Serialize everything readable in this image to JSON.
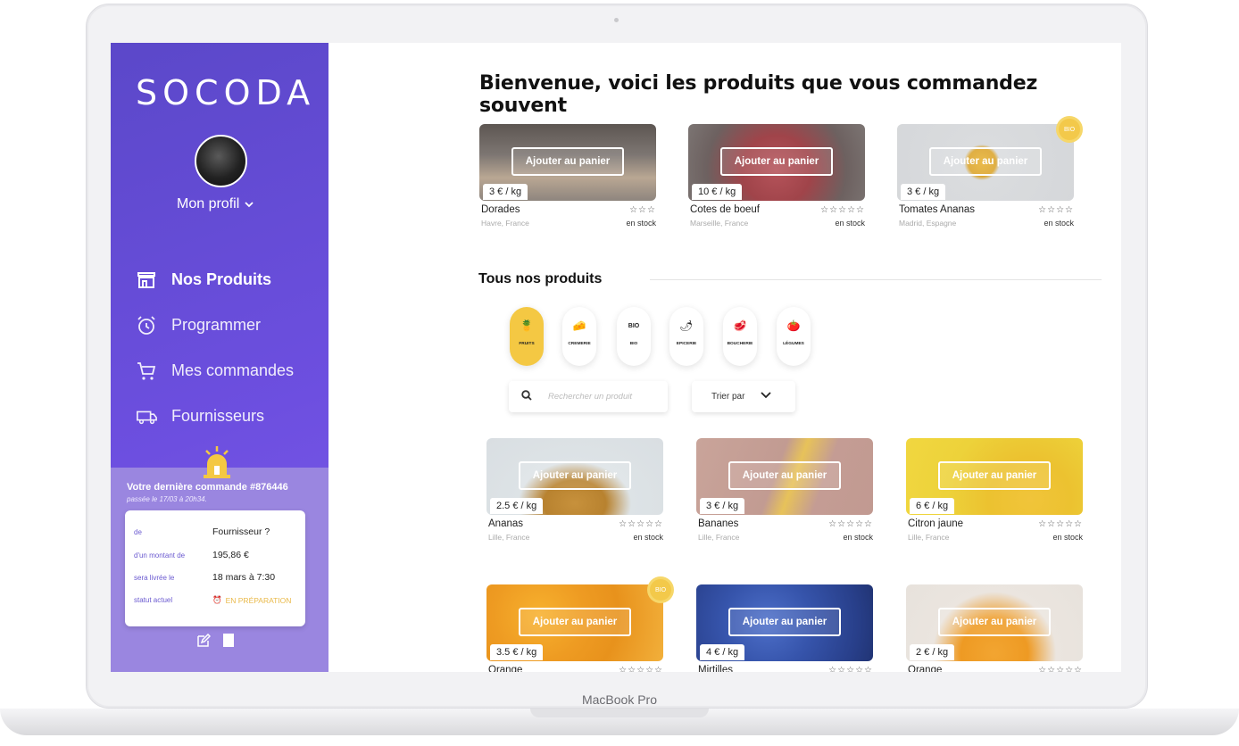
{
  "device": {
    "label": "MacBook Pro"
  },
  "sidebar": {
    "logo": "SOCODA",
    "profile_label": "Mon profil",
    "nav": [
      {
        "label": "Nos Produits",
        "icon": "store-icon",
        "active": true
      },
      {
        "label": "Programmer",
        "icon": "alarm-clock-icon",
        "active": false
      },
      {
        "label": "Mes commandes",
        "icon": "cart-icon",
        "active": false
      },
      {
        "label": "Fournisseurs",
        "icon": "truck-icon",
        "active": false
      }
    ],
    "last_order": {
      "title": "Votre dernière commande #876446",
      "subtitle": "passée le 17/03 à 20h34.",
      "rows": [
        {
          "label": "de",
          "value": "Fournisseur ?"
        },
        {
          "label": "d'un montant de",
          "value": "195,86 €"
        },
        {
          "label": "sera livrée le",
          "value": "18 mars à 7:30"
        },
        {
          "label": "statut actuel",
          "value": "EN PRÉPARATION"
        }
      ]
    }
  },
  "main": {
    "welcome": "Bienvenue, voici les produits que vous commandez souvent",
    "add_button_label": "Ajouter au panier",
    "bio_label": "BIO",
    "favorites": [
      {
        "name": "Dorades",
        "price": "3 € / kg",
        "location": "Havre, France",
        "stock": "en stock",
        "stars": "☆☆☆",
        "bio": false
      },
      {
        "name": "Cotes de boeuf",
        "price": "10 € / kg",
        "location": "Marseille, France",
        "stock": "en stock",
        "stars": "☆☆☆☆☆",
        "bio": false
      },
      {
        "name": "Tomates Ananas",
        "price": "3 € / kg",
        "location": "Madrid, Espagne",
        "stock": "en stock",
        "stars": "☆☆☆☆",
        "bio": true
      }
    ],
    "all_title": "Tous nos produits",
    "categories": [
      {
        "label": "FRUITS",
        "icon": "🍍",
        "active": true
      },
      {
        "label": "CREMERIE",
        "icon": "🧀",
        "active": false
      },
      {
        "label": "BIO",
        "icon": "BIO",
        "active": false
      },
      {
        "label": "EPICERIE",
        "icon": "🌶",
        "active": false
      },
      {
        "label": "BOUCHERIE",
        "icon": "🥩",
        "active": false
      },
      {
        "label": "LÉGUMES",
        "icon": "🍅",
        "active": false
      }
    ],
    "search_placeholder": "Rechercher un produit",
    "sort_label": "Trier par",
    "products": [
      {
        "name": "Ananas",
        "price": "2.5 € / kg",
        "location": "Lille, France",
        "stock": "en stock",
        "stars": "☆☆☆☆☆",
        "bio": false
      },
      {
        "name": "Bananes",
        "price": "3 € / kg",
        "location": "Lille, France",
        "stock": "en stock",
        "stars": "☆☆☆☆☆",
        "bio": false
      },
      {
        "name": "Citron jaune",
        "price": "6 € / kg",
        "location": "Lille, France",
        "stock": "en stock",
        "stars": "☆☆☆☆☆",
        "bio": false
      },
      {
        "name": "Orange",
        "price": "3.5 € / kg",
        "location": "",
        "stock": "",
        "stars": "☆☆☆☆☆",
        "bio": true
      },
      {
        "name": "Mirtilles",
        "price": "4 € / kg",
        "location": "",
        "stock": "",
        "stars": "☆☆☆☆☆",
        "bio": false
      },
      {
        "name": "Orange",
        "price": "2 € / kg",
        "location": "",
        "stock": "",
        "stars": "☆☆☆☆☆",
        "bio": false
      }
    ]
  }
}
